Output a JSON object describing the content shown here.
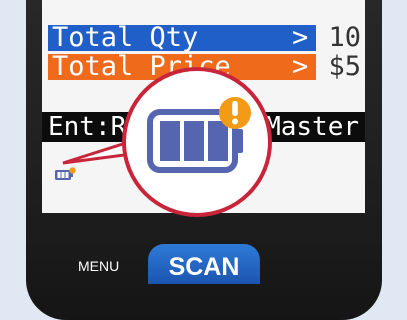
{
  "screen": {
    "total_qty_label": "Total Qty",
    "total_qty_arrow": ">",
    "total_qty_value": "10",
    "total_price_label": "Total Price",
    "total_price_arrow": ">",
    "total_price_value": "$5",
    "status_left": "Ent:R",
    "status_right": "Master"
  },
  "buttons": {
    "menu_label": "MENU",
    "scan_label": "SCAN"
  },
  "colors": {
    "qty_row": "#1f5fc7",
    "price_row": "#f06a1c",
    "scan_button": "#1b55b0",
    "callout_ring": "#c8253a",
    "battery": "#5565b0",
    "alert_badge": "#f39b16"
  },
  "icons": [
    "battery-low-icon",
    "alert-badge-icon"
  ]
}
